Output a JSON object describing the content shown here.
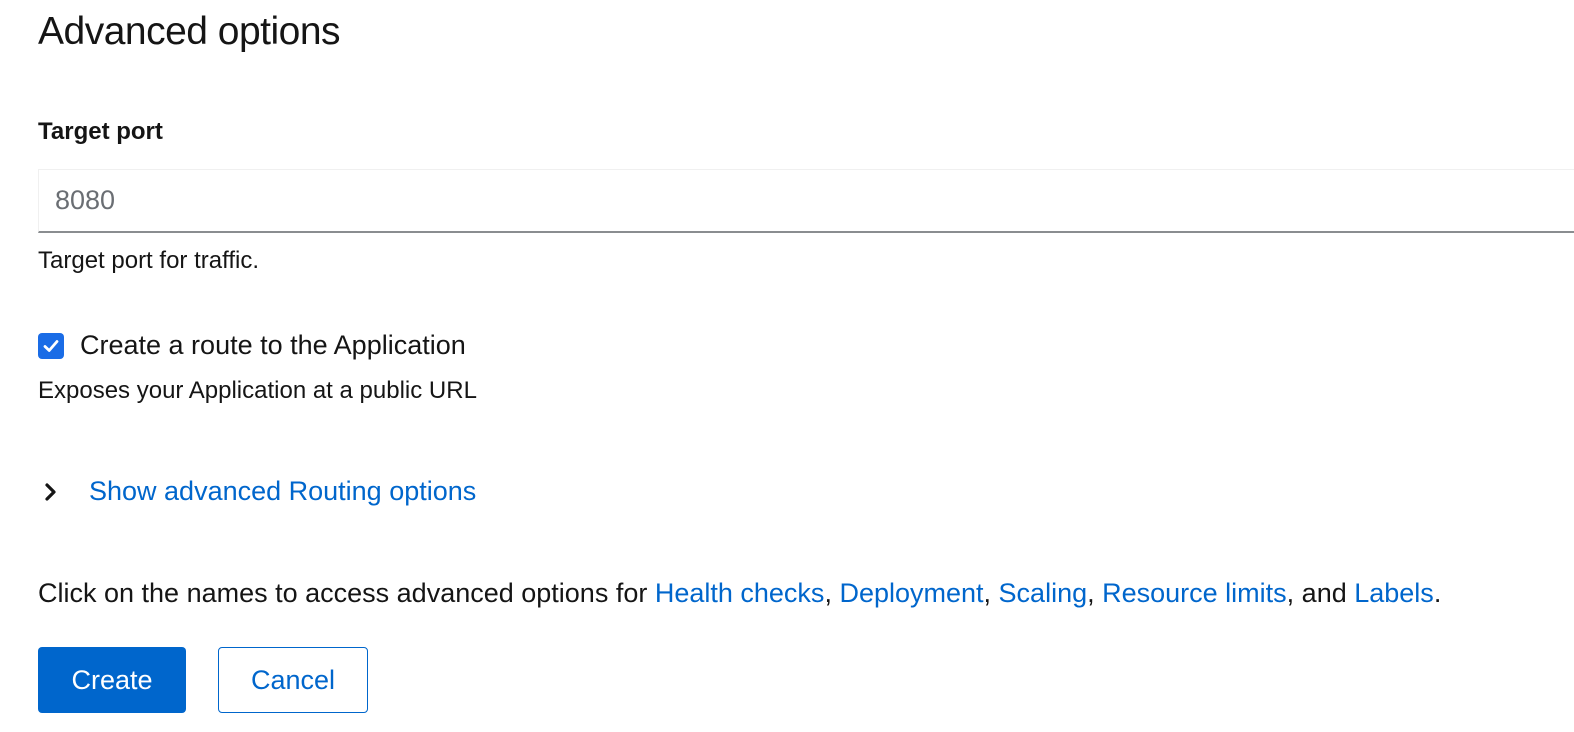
{
  "section": {
    "title": "Advanced options"
  },
  "target_port": {
    "label": "Target port",
    "placeholder": "8080",
    "value": "",
    "helper": "Target port for traffic."
  },
  "route": {
    "checked": true,
    "label": "Create a route to the Application",
    "description": "Exposes your Application at a public URL"
  },
  "routing": {
    "toggle_label": "Show advanced Routing options",
    "icon": "chevron-right-icon"
  },
  "advanced_links": {
    "prefix": "Click on the names to access advanced options for ",
    "health_checks": "Health checks",
    "sep1": ", ",
    "deployment": "Deployment",
    "sep2": ", ",
    "scaling": "Scaling",
    "sep3": ", ",
    "resource_limits": "Resource limits",
    "sep4": ", and ",
    "labels": "Labels",
    "suffix": "."
  },
  "actions": {
    "create_label": "Create",
    "cancel_label": "Cancel"
  },
  "colors": {
    "primary": "#0066cc",
    "checkbox": "#1a6ce6",
    "text": "#151515"
  }
}
